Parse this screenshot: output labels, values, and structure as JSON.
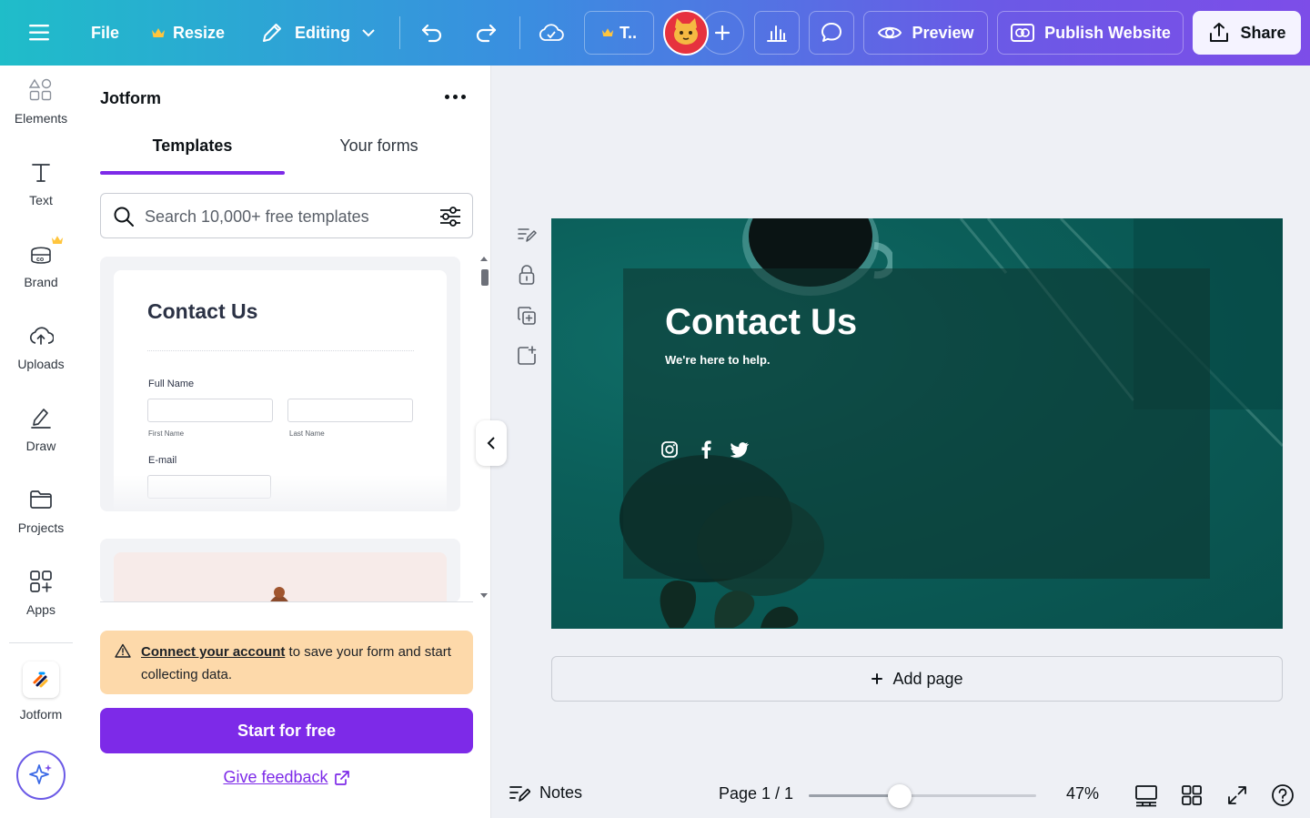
{
  "topbar": {
    "menu_icon": "hamburger-icon",
    "file_label": "File",
    "resize_label": "Resize",
    "editing_label": "Editing",
    "team_label": "T..",
    "preview_label": "Preview",
    "publish_label": "Publish Website",
    "share_label": "Share",
    "colors": {
      "gradient_start": "#1fbdc9",
      "gradient_end": "#7d4de8",
      "crown": "#ffc53d"
    }
  },
  "rail": {
    "items": [
      {
        "label": "Elements",
        "icon": "shapes-icon"
      },
      {
        "label": "Text",
        "icon": "text-t-icon"
      },
      {
        "label": "Brand",
        "icon": "brand-kit-icon"
      },
      {
        "label": "Uploads",
        "icon": "cloud-upload-icon"
      },
      {
        "label": "Draw",
        "icon": "pen-draw-icon"
      },
      {
        "label": "Projects",
        "icon": "folder-icon"
      },
      {
        "label": "Apps",
        "icon": "apps-grid-icon"
      },
      {
        "label": "Jotform",
        "icon": "jotform-logo-icon"
      }
    ],
    "magic_icon": "sparkle-icon"
  },
  "panel": {
    "title": "Jotform",
    "tabs": [
      {
        "label": "Templates",
        "active": true
      },
      {
        "label": "Your forms",
        "active": false
      }
    ],
    "search": {
      "placeholder": "Search 10,000+ free templates",
      "value": ""
    },
    "template_preview": {
      "title": "Contact Us",
      "full_name_label": "Full Name",
      "first_name_label": "First Name",
      "last_name_label": "Last Name",
      "email_label": "E-mail"
    },
    "warning": {
      "link": "Connect your account",
      "text": " to save your form and start collecting data."
    },
    "cta_label": "Start for free",
    "feedback_label": "Give feedback",
    "accent": "#7d2ae8",
    "warning_bg": "#fdd9aa"
  },
  "design": {
    "title": "Contact Us",
    "subtitle": "We're here to help.",
    "social_icons": [
      "instagram-icon",
      "facebook-icon",
      "twitter-icon"
    ],
    "bg_color": "#0b5e59"
  },
  "canvas": {
    "add_page_label": "Add page"
  },
  "bottombar": {
    "notes_label": "Notes",
    "page_indicator": "Page 1 / 1",
    "zoom_label": "47%",
    "zoom_fraction": 0.4
  }
}
